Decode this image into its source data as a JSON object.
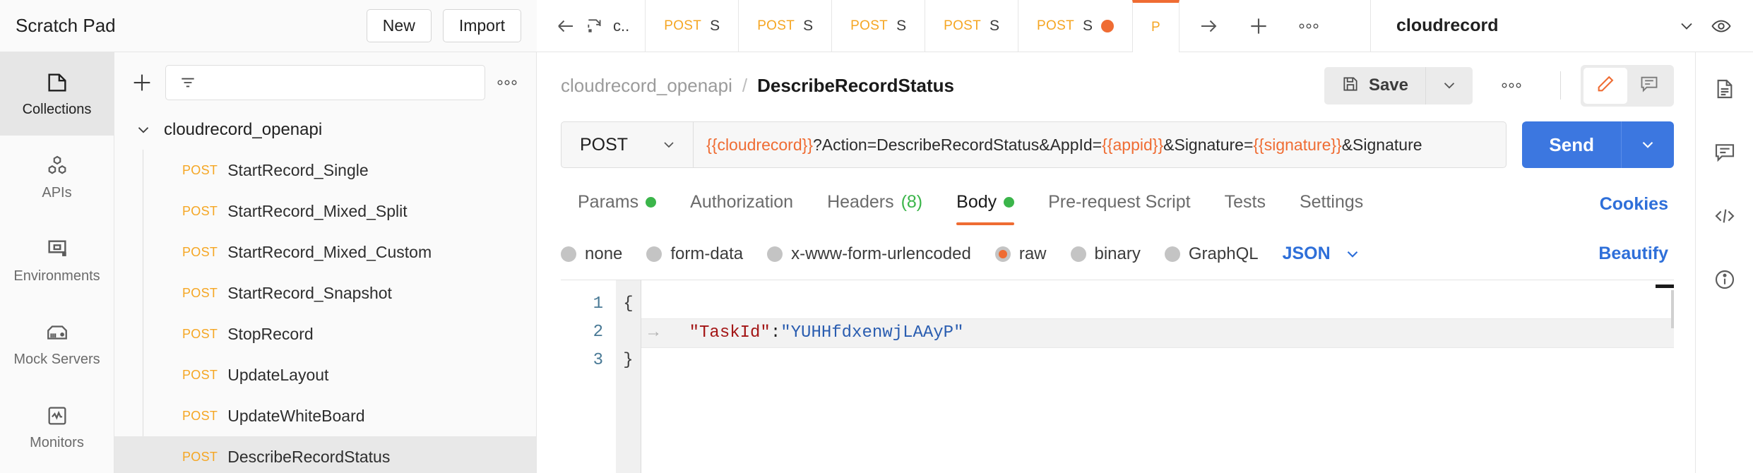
{
  "header": {
    "scratch_pad_title": "Scratch Pad",
    "new_button": "New",
    "import_button": "Import",
    "back_icon": "arrow-left-icon",
    "current_collection_short": "c..",
    "forward_icon": "arrow-right-icon",
    "new_tab_icon": "plus-icon",
    "more_icon": "ellipsis-icon",
    "workspace_name": "cloudrecord",
    "workspace_caret_icon": "chevron-down-icon",
    "watch_icon": "eye-icon"
  },
  "tabs": [
    {
      "method": "POST",
      "name": "S",
      "dirty": false,
      "active": false
    },
    {
      "method": "POST",
      "name": "S",
      "dirty": false,
      "active": false
    },
    {
      "method": "POST",
      "name": "S",
      "dirty": false,
      "active": false
    },
    {
      "method": "POST",
      "name": "S",
      "dirty": false,
      "active": false
    },
    {
      "method": "POST",
      "name": "S",
      "dirty": true,
      "active": false
    },
    {
      "method": "P",
      "name": "",
      "dirty": false,
      "active": true
    }
  ],
  "left_rail": [
    {
      "label": "Collections",
      "icon": "collections-icon",
      "active": true
    },
    {
      "label": "APIs",
      "icon": "apis-icon",
      "active": false
    },
    {
      "label": "Environments",
      "icon": "environments-icon",
      "active": false
    },
    {
      "label": "Mock Servers",
      "icon": "mock-servers-icon",
      "active": false
    },
    {
      "label": "Monitors",
      "icon": "monitors-icon",
      "active": false
    }
  ],
  "sidebar": {
    "add_icon": "plus-icon",
    "filter_icon": "filter-icon",
    "filter_placeholder": "",
    "more_icon": "ellipsis-icon",
    "collection_name": "cloudrecord_openapi",
    "collection_chevron_icon": "chevron-down-icon",
    "requests": [
      {
        "method": "POST",
        "name": "StartRecord_Single",
        "selected": false
      },
      {
        "method": "POST",
        "name": "StartRecord_Mixed_Split",
        "selected": false
      },
      {
        "method": "POST",
        "name": "StartRecord_Mixed_Custom",
        "selected": false
      },
      {
        "method": "POST",
        "name": "StartRecord_Snapshot",
        "selected": false
      },
      {
        "method": "POST",
        "name": "StopRecord",
        "selected": false
      },
      {
        "method": "POST",
        "name": "UpdateLayout",
        "selected": false
      },
      {
        "method": "POST",
        "name": "UpdateWhiteBoard",
        "selected": false
      },
      {
        "method": "POST",
        "name": "DescribeRecordStatus",
        "selected": true
      }
    ]
  },
  "breadcrumb": {
    "parent": "cloudrecord_openapi",
    "separator": "/",
    "current": "DescribeRecordStatus",
    "save_label": "Save",
    "save_icon": "floppy-disk-icon",
    "save_caret_icon": "chevron-down-icon",
    "more_icon": "ellipsis-icon",
    "edit_icon": "pencil-icon",
    "comment_icon": "comment-icon"
  },
  "request": {
    "method": "POST",
    "method_caret_icon": "chevron-down-icon",
    "url_segments": [
      {
        "text": "{{cloudrecord}}",
        "variable": true
      },
      {
        "text": "?Action=DescribeRecordStatus&AppId=",
        "variable": false
      },
      {
        "text": "{{appid}}",
        "variable": true
      },
      {
        "text": "&Signature=",
        "variable": false
      },
      {
        "text": "{{signature}}",
        "variable": true
      },
      {
        "text": "&Signature",
        "variable": false
      }
    ],
    "send_label": "Send",
    "send_caret_icon": "chevron-down-icon"
  },
  "request_tabs": [
    {
      "label": "Params",
      "active": false,
      "dot": true,
      "count": ""
    },
    {
      "label": "Authorization",
      "active": false,
      "dot": false,
      "count": ""
    },
    {
      "label": "Headers",
      "active": false,
      "dot": false,
      "count": "(8)"
    },
    {
      "label": "Body",
      "active": true,
      "dot": true,
      "count": ""
    },
    {
      "label": "Pre-request Script",
      "active": false,
      "dot": false,
      "count": ""
    },
    {
      "label": "Tests",
      "active": false,
      "dot": false,
      "count": ""
    },
    {
      "label": "Settings",
      "active": false,
      "dot": false,
      "count": ""
    }
  ],
  "cookies_link": "Cookies",
  "body_options": [
    {
      "label": "none",
      "selected": false
    },
    {
      "label": "form-data",
      "selected": false
    },
    {
      "label": "x-www-form-urlencoded",
      "selected": false
    },
    {
      "label": "raw",
      "selected": true
    },
    {
      "label": "binary",
      "selected": false
    },
    {
      "label": "GraphQL",
      "selected": false
    }
  ],
  "body_format": "JSON",
  "body_format_caret_icon": "chevron-down-icon",
  "beautify_label": "Beautify",
  "editor": {
    "line_numbers": [
      "1",
      "2",
      "3"
    ],
    "lines": [
      {
        "fold": "{",
        "indent_arrow": false,
        "highlight": false,
        "tokens": []
      },
      {
        "fold": "",
        "indent_arrow": true,
        "highlight": true,
        "tokens": [
          {
            "text": "\"TaskId\"",
            "type": "key"
          },
          {
            "text": ":",
            "type": "punc"
          },
          {
            "text": "\"YUHHfdxenwjLAAyP\"",
            "type": "string"
          }
        ]
      },
      {
        "fold": "}",
        "indent_arrow": false,
        "highlight": false,
        "tokens": []
      }
    ]
  },
  "right_rail": [
    {
      "icon": "documentation-icon"
    },
    {
      "icon": "comment-icon"
    },
    {
      "icon": "code-icon"
    },
    {
      "icon": "info-icon"
    }
  ],
  "colors": {
    "accent_orange": "#ef6c33",
    "method_orange": "#f5a623",
    "send_blue": "#3c77e0",
    "link_blue": "#2e6fd9",
    "status_green": "#3bb54a"
  }
}
